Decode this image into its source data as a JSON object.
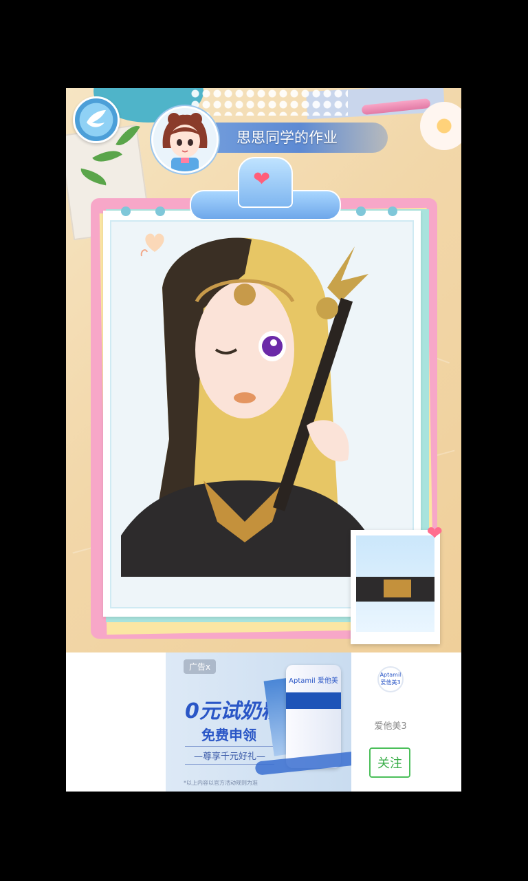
{
  "header": {
    "title": "思思同学的作业",
    "back_icon": "wing-back-icon",
    "avatar_icon": "chibi-girl-avatar"
  },
  "board": {
    "clip_icon": "heart-icon",
    "portrait_icon": "princess-portrait",
    "thumbnail_icon": "portrait-thumbnail"
  },
  "ad": {
    "tag": "广告x",
    "headline": "0元试奶粉",
    "subline": "免费申领",
    "perk": "—尊享千元好礼—",
    "fine_print": "*以上内容以官方活动规则为准",
    "can_label": "Aptamil 爱他美",
    "brand_logo_text": "Aptamil 爱他美3",
    "brand_name": "爱他美3",
    "follow_label": "关注"
  },
  "colors": {
    "accent_blue": "#5d8ad3",
    "board_pink": "#f7a7c8",
    "follow_green": "#4bbf5a"
  }
}
